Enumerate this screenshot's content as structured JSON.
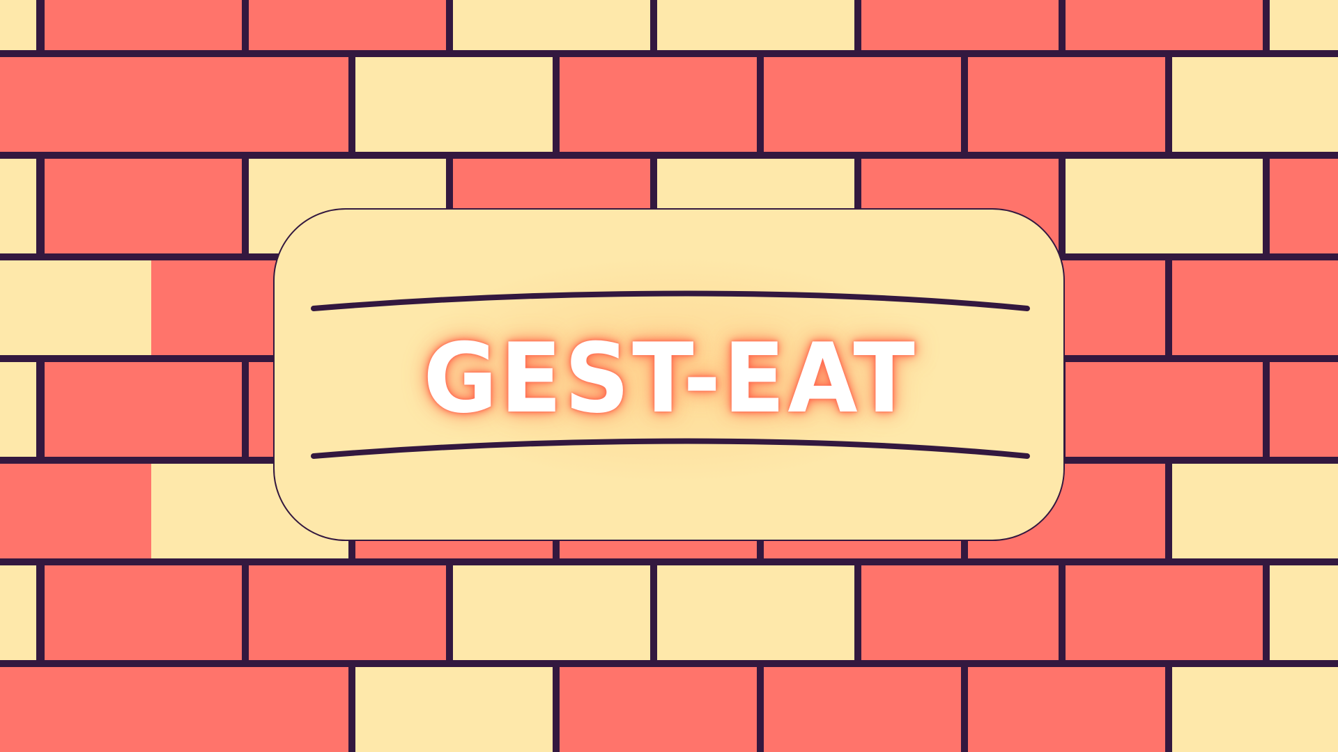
{
  "title": "GEST-EAT",
  "colors": {
    "mortar": "#33183f",
    "brick_red": "#ff746b",
    "brick_cream": "#fee8aa",
    "card_background": "#fee8aa",
    "title_text": "#ffffff",
    "title_glow": "#ff6e58"
  },
  "brick_wall": {
    "row_patterns": [
      [
        "cream",
        "red",
        "red",
        "cream",
        "cream",
        "red",
        "red",
        "cream",
        "red"
      ],
      [
        "red",
        "red",
        "cream",
        "red",
        "red",
        "red",
        "cream",
        "cream"
      ],
      [
        "cream",
        "red",
        "cream",
        "red",
        "cream",
        "red",
        "cream",
        "red",
        "red"
      ],
      [
        "cream",
        "red",
        "red",
        "red",
        "red",
        "red",
        "red",
        "red"
      ],
      [
        "cream",
        "red",
        "red",
        "red",
        "red",
        "red",
        "red",
        "red",
        "red"
      ],
      [
        "red",
        "cream",
        "red",
        "red",
        "red",
        "red",
        "cream",
        "cream"
      ],
      [
        "cream",
        "red",
        "red",
        "cream",
        "cream",
        "red",
        "red",
        "cream",
        "red"
      ],
      [
        "red",
        "red",
        "cream",
        "red",
        "red",
        "red",
        "cream",
        "cream"
      ]
    ]
  }
}
